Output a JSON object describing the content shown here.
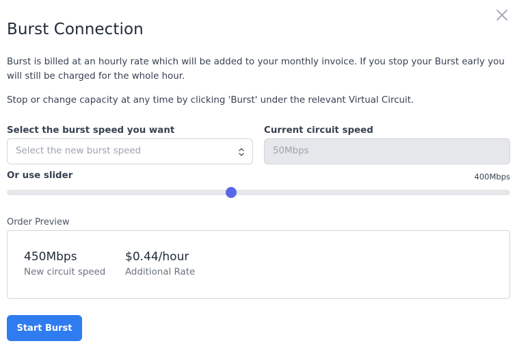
{
  "modal": {
    "title": "Burst Connection",
    "description_1": "Burst is billed at an hourly rate which will be added to your monthly invoice. If you stop your Burst early you will still be charged for the whole hour.",
    "description_2": "Stop or change capacity at any time by clicking 'Burst' under the relevant Virtual Circuit.",
    "close_icon": "close-icon"
  },
  "burst_speed": {
    "label": "Select the burst speed you want",
    "placeholder": "Select the new burst speed",
    "icon": "chevron-up-down-icon"
  },
  "current_speed": {
    "label": "Current circuit speed",
    "value": "50Mbps"
  },
  "slider": {
    "label": "Or use slider",
    "max_label": "400Mbps",
    "position_fraction": 0.446
  },
  "order_preview": {
    "label": "Order Preview",
    "items": [
      {
        "value": "450Mbps",
        "caption": "New circuit speed"
      },
      {
        "value": "$0.44/hour",
        "caption": "Additional Rate"
      }
    ]
  },
  "actions": {
    "start_label": "Start Burst"
  },
  "colors": {
    "accent": "#2f7bf0",
    "slider_thumb": "#5a67e8",
    "disabled_field": "#e5e7eb"
  }
}
